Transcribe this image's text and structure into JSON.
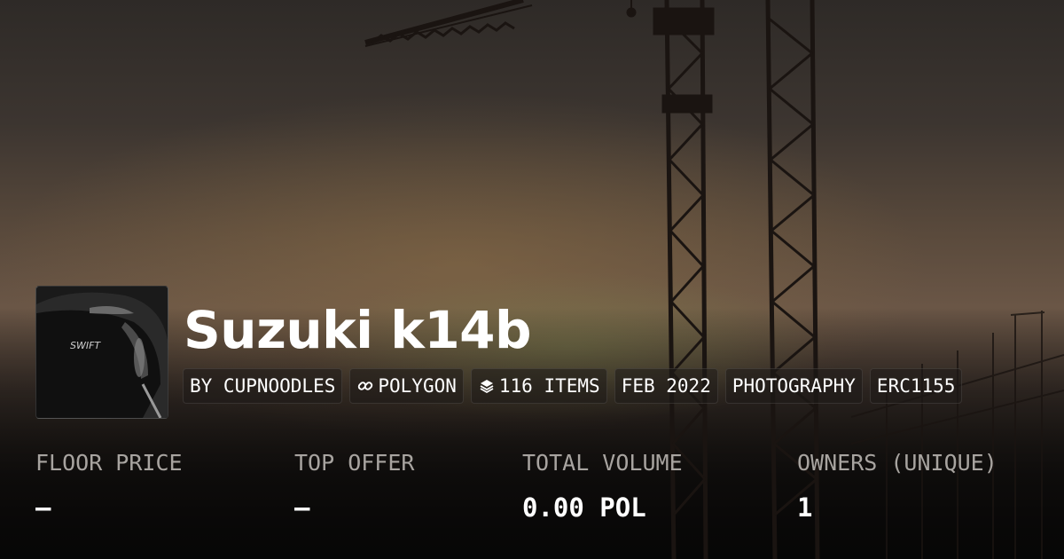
{
  "collection": {
    "title": "Suzuki k14b",
    "avatar_icon": "car-photo-thumbnail"
  },
  "chips": [
    {
      "label": "BY CUPNOODLES",
      "icon": ""
    },
    {
      "label": "POLYGON",
      "icon": "link-chain-icon"
    },
    {
      "label": "116 ITEMS",
      "icon": "layers-icon"
    },
    {
      "label": "FEB 2022",
      "icon": ""
    },
    {
      "label": "PHOTOGRAPHY",
      "icon": ""
    },
    {
      "label": "ERC1155",
      "icon": ""
    }
  ],
  "stats": [
    {
      "label": "FLOOR PRICE",
      "value": "—"
    },
    {
      "label": "TOP OFFER",
      "value": "—"
    },
    {
      "label": "TOTAL VOLUME",
      "value": "0.00 POL"
    },
    {
      "label": "OWNERS (UNIQUE)",
      "value": "1"
    }
  ],
  "colors": {
    "text": "#ffffff",
    "muted": "#a8a4a0",
    "chip_bg": "#1e1a18"
  }
}
